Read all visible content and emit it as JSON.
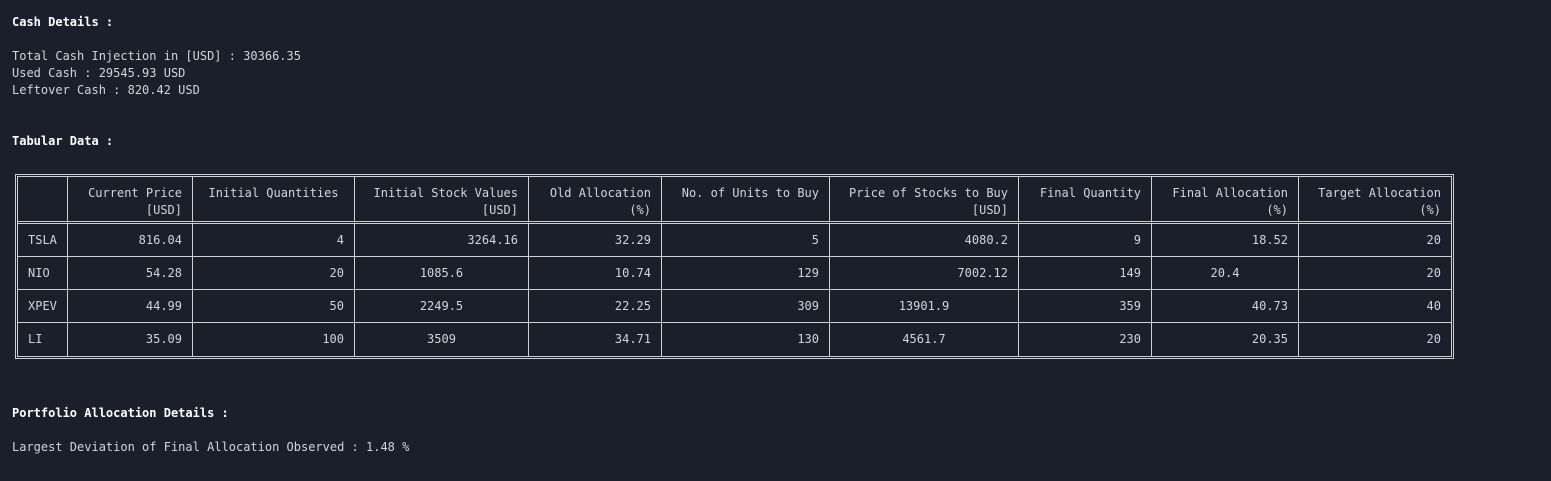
{
  "cash": {
    "heading": "Cash Details :",
    "total_injection": "Total Cash Injection in [USD] : 30366.35",
    "used": "Used Cash : 29545.93 USD",
    "leftover": "Leftover Cash : 820.42 USD"
  },
  "tabular": {
    "heading": "Tabular Data :"
  },
  "table": {
    "columns": [
      {
        "l1": "",
        "l2": ""
      },
      {
        "l1": "Current Price",
        "l2": "[USD]"
      },
      {
        "l1": "Initial Quantities",
        "l2": ""
      },
      {
        "l1": "Initial Stock Values",
        "l2": "[USD]"
      },
      {
        "l1": "Old Allocation",
        "l2": "(%)"
      },
      {
        "l1": "No. of Units to Buy",
        "l2": ""
      },
      {
        "l1": "Price of Stocks to Buy",
        "l2": "[USD]"
      },
      {
        "l1": "Final Quantity",
        "l2": ""
      },
      {
        "l1": "Final Allocation",
        "l2": "(%)"
      },
      {
        "l1": "Target Allocation",
        "l2": "(%)"
      }
    ],
    "rows": [
      [
        "TSLA",
        "816.04",
        "4",
        "3264.16",
        "32.29",
        "5",
        "4080.2",
        "9",
        "18.52",
        "20"
      ],
      [
        "NIO",
        "54.28",
        "20",
        "1085.6",
        "10.74",
        "129",
        "7002.12",
        "149",
        "20.4",
        "20"
      ],
      [
        "XPEV",
        "44.99",
        "50",
        "2249.5",
        "22.25",
        "309",
        "13901.9",
        "359",
        "40.73",
        "40"
      ],
      [
        "LI",
        "35.09",
        "100",
        "3509",
        "34.71",
        "130",
        "4561.7",
        "230",
        "20.35",
        "20"
      ]
    ]
  },
  "portfolio": {
    "heading": "Portfolio Allocation Details :",
    "largest_deviation": "Largest Deviation of Final Allocation Observed : 1.48 %"
  }
}
